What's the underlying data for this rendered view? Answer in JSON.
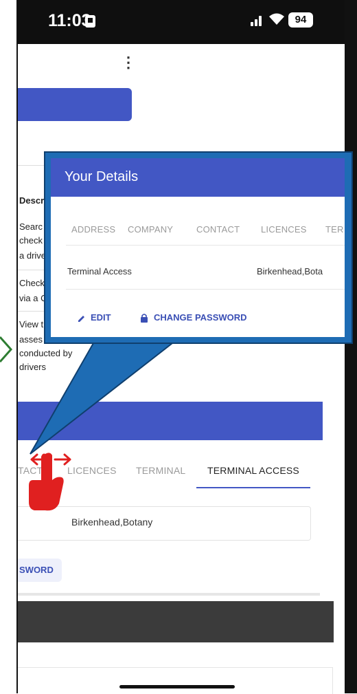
{
  "status_bar": {
    "time": "11:03",
    "battery": "94"
  },
  "background_page": {
    "description_header": "Descr",
    "description_lines": [
      "Searc",
      "check",
      "a drive",
      "Check",
      "via a C",
      "View t",
      "asses",
      "conducted by",
      "drivers"
    ],
    "tabs": [
      {
        "label": "TACT",
        "active": false
      },
      {
        "label": "LICENCES",
        "active": false
      },
      {
        "label": "TERMINAL",
        "active": false
      },
      {
        "label": "TERMINAL ACCESS",
        "active": true
      }
    ],
    "terminal_access_value": "Birkenhead,Botany",
    "change_password_partial": "SWORD"
  },
  "callout": {
    "title": "Your Details",
    "tabs": [
      "ADDRESS",
      "COMPANY",
      "CONTACT",
      "LICENCES",
      "TER"
    ],
    "row_label": "Terminal Access",
    "row_value": "Birkenhead,Bota",
    "edit_label": "EDIT",
    "change_password_label": "CHANGE PASSWORD"
  },
  "colors": {
    "primary": "#4257c4",
    "callout_fill": "#1e6cb4",
    "gesture": "#e02020"
  },
  "icons": {
    "gesture": "swipe-hand-icon",
    "edit": "pencil-icon",
    "password": "lock-icon"
  }
}
